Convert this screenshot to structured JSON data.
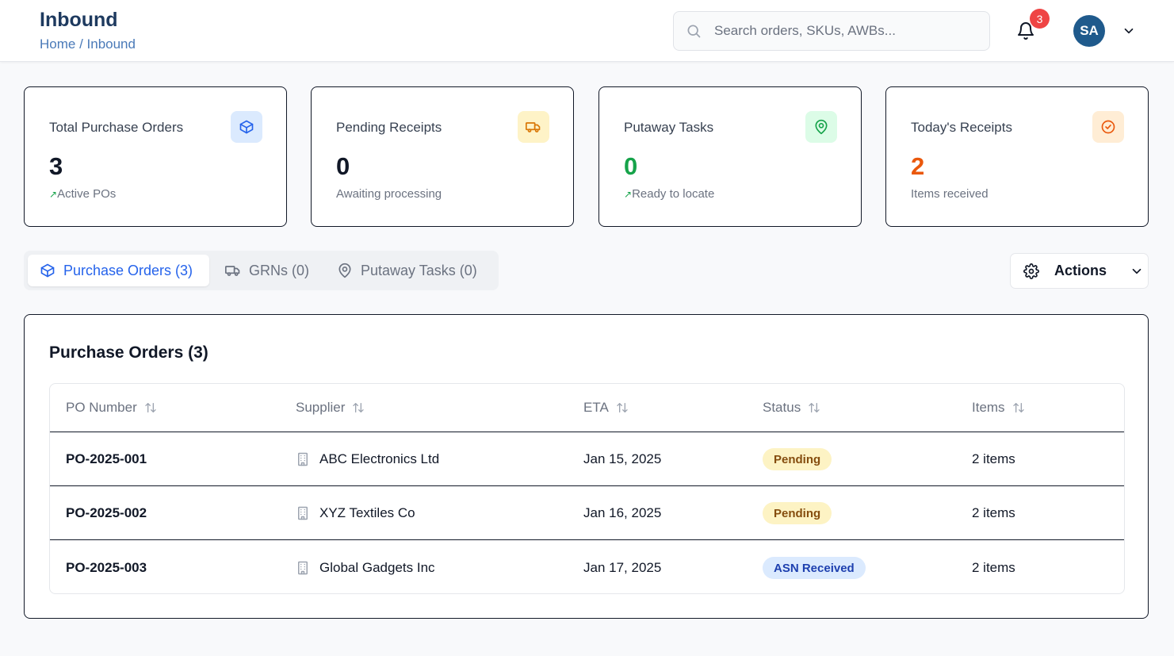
{
  "header": {
    "title": "Inbound",
    "breadcrumb": "Home / Inbound",
    "search_placeholder": "Search orders, SKUs, AWBs...",
    "notification_count": "3",
    "avatar_initials": "SA"
  },
  "stats": [
    {
      "label": "Total Purchase Orders",
      "value": "3",
      "sub": "Active POs",
      "trend": "↗",
      "color": "#111827",
      "icon": "package-icon",
      "icon_bg": "#dbeafe",
      "icon_color": "#2563eb"
    },
    {
      "label": "Pending Receipts",
      "value": "0",
      "sub": "Awaiting processing",
      "trend": "",
      "color": "#111827",
      "icon": "truck-icon",
      "icon_bg": "#fef3c7",
      "icon_color": "#d97706"
    },
    {
      "label": "Putaway Tasks",
      "value": "0",
      "sub": "Ready to locate",
      "trend": "↗",
      "color": "#16a34a",
      "icon": "map-pin-icon",
      "icon_bg": "#dcfce7",
      "icon_color": "#16a34a"
    },
    {
      "label": "Today's Receipts",
      "value": "2",
      "sub": "Items received",
      "trend": "",
      "color": "#ea580c",
      "icon": "check-circle-icon",
      "icon_bg": "#ffedd5",
      "icon_color": "#ea580c"
    }
  ],
  "tabs": [
    {
      "label": "Purchase Orders (3)",
      "icon": "package-icon",
      "active": true
    },
    {
      "label": "GRNs (0)",
      "icon": "truck-icon",
      "active": false
    },
    {
      "label": "Putaway Tasks (0)",
      "icon": "map-pin-icon",
      "active": false
    }
  ],
  "actions_label": "Actions",
  "panel": {
    "title": "Purchase Orders (3)",
    "columns": [
      "PO Number",
      "Supplier",
      "ETA",
      "Status",
      "Items"
    ],
    "rows": [
      {
        "po": "PO-2025-001",
        "supplier": "ABC Electronics Ltd",
        "eta": "Jan 15, 2025",
        "status": "Pending",
        "status_type": "pending",
        "items": "2 items"
      },
      {
        "po": "PO-2025-002",
        "supplier": "XYZ Textiles Co",
        "eta": "Jan 16, 2025",
        "status": "Pending",
        "status_type": "pending",
        "items": "2 items"
      },
      {
        "po": "PO-2025-003",
        "supplier": "Global Gadgets Inc",
        "eta": "Jan 17, 2025",
        "status": "ASN Received",
        "status_type": "asn",
        "items": "2 items"
      }
    ]
  },
  "colors": {
    "accent": "#2563eb",
    "title": "#1e3a5f",
    "avatar_bg": "#1f5a8c",
    "badge_red": "#ef4444"
  }
}
